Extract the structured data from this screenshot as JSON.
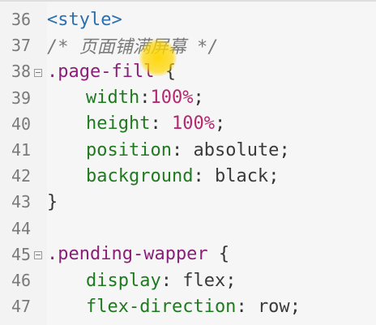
{
  "editor": {
    "lines": [
      {
        "n": "36",
        "fold": false,
        "parts": [
          {
            "c": "tag",
            "t": "<style>"
          }
        ]
      },
      {
        "n": "37",
        "fold": false,
        "parts": [
          {
            "c": "comment",
            "t": "/* 页面铺满屏幕 */"
          }
        ]
      },
      {
        "n": "38",
        "fold": true,
        "parts": [
          {
            "c": "sel",
            "t": ".page-fill"
          },
          {
            "c": "punc",
            "t": " {"
          }
        ]
      },
      {
        "n": "39",
        "fold": false,
        "indent": true,
        "parts": [
          {
            "c": "prop",
            "t": "width"
          },
          {
            "c": "punc",
            "t": ":"
          },
          {
            "c": "num",
            "t": "100%"
          },
          {
            "c": "punc",
            "t": ";"
          }
        ]
      },
      {
        "n": "40",
        "fold": false,
        "indent": true,
        "parts": [
          {
            "c": "prop",
            "t": "height"
          },
          {
            "c": "punc",
            "t": ": "
          },
          {
            "c": "num",
            "t": "100%"
          },
          {
            "c": "punc",
            "t": ";"
          }
        ]
      },
      {
        "n": "41",
        "fold": false,
        "indent": true,
        "parts": [
          {
            "c": "prop",
            "t": "position"
          },
          {
            "c": "punc",
            "t": ": "
          },
          {
            "c": "val",
            "t": "absolute"
          },
          {
            "c": "punc",
            "t": ";"
          }
        ]
      },
      {
        "n": "42",
        "fold": false,
        "indent": true,
        "parts": [
          {
            "c": "prop",
            "t": "background"
          },
          {
            "c": "punc",
            "t": ": "
          },
          {
            "c": "val",
            "t": "black"
          },
          {
            "c": "punc",
            "t": ";"
          }
        ]
      },
      {
        "n": "43",
        "fold": false,
        "parts": [
          {
            "c": "punc",
            "t": "}"
          }
        ]
      },
      {
        "n": "44",
        "fold": false,
        "parts": []
      },
      {
        "n": "45",
        "fold": true,
        "parts": [
          {
            "c": "sel",
            "t": ".pending-wapper"
          },
          {
            "c": "punc",
            "t": " {"
          }
        ]
      },
      {
        "n": "46",
        "fold": false,
        "indent": true,
        "parts": [
          {
            "c": "prop",
            "t": "display"
          },
          {
            "c": "punc",
            "t": ": "
          },
          {
            "c": "val",
            "t": "flex"
          },
          {
            "c": "punc",
            "t": ";"
          }
        ]
      },
      {
        "n": "47",
        "fold": false,
        "indent": true,
        "parts": [
          {
            "c": "prop",
            "t": "flex-direction"
          },
          {
            "c": "punc",
            "t": ": "
          },
          {
            "c": "val",
            "t": "row"
          },
          {
            "c": "punc",
            "t": ";"
          }
        ]
      }
    ]
  },
  "colors": {
    "tag": "#2a6fb0",
    "comment": "#7a7a7a",
    "selector": "#8b1e78",
    "property": "#1f7a1f",
    "number": "#b3286f",
    "cursor_highlight": "#ffd600"
  },
  "icons": {
    "fold_marker": "fold-collapse-icon",
    "cursor": "mouse-cursor-highlight-icon"
  }
}
